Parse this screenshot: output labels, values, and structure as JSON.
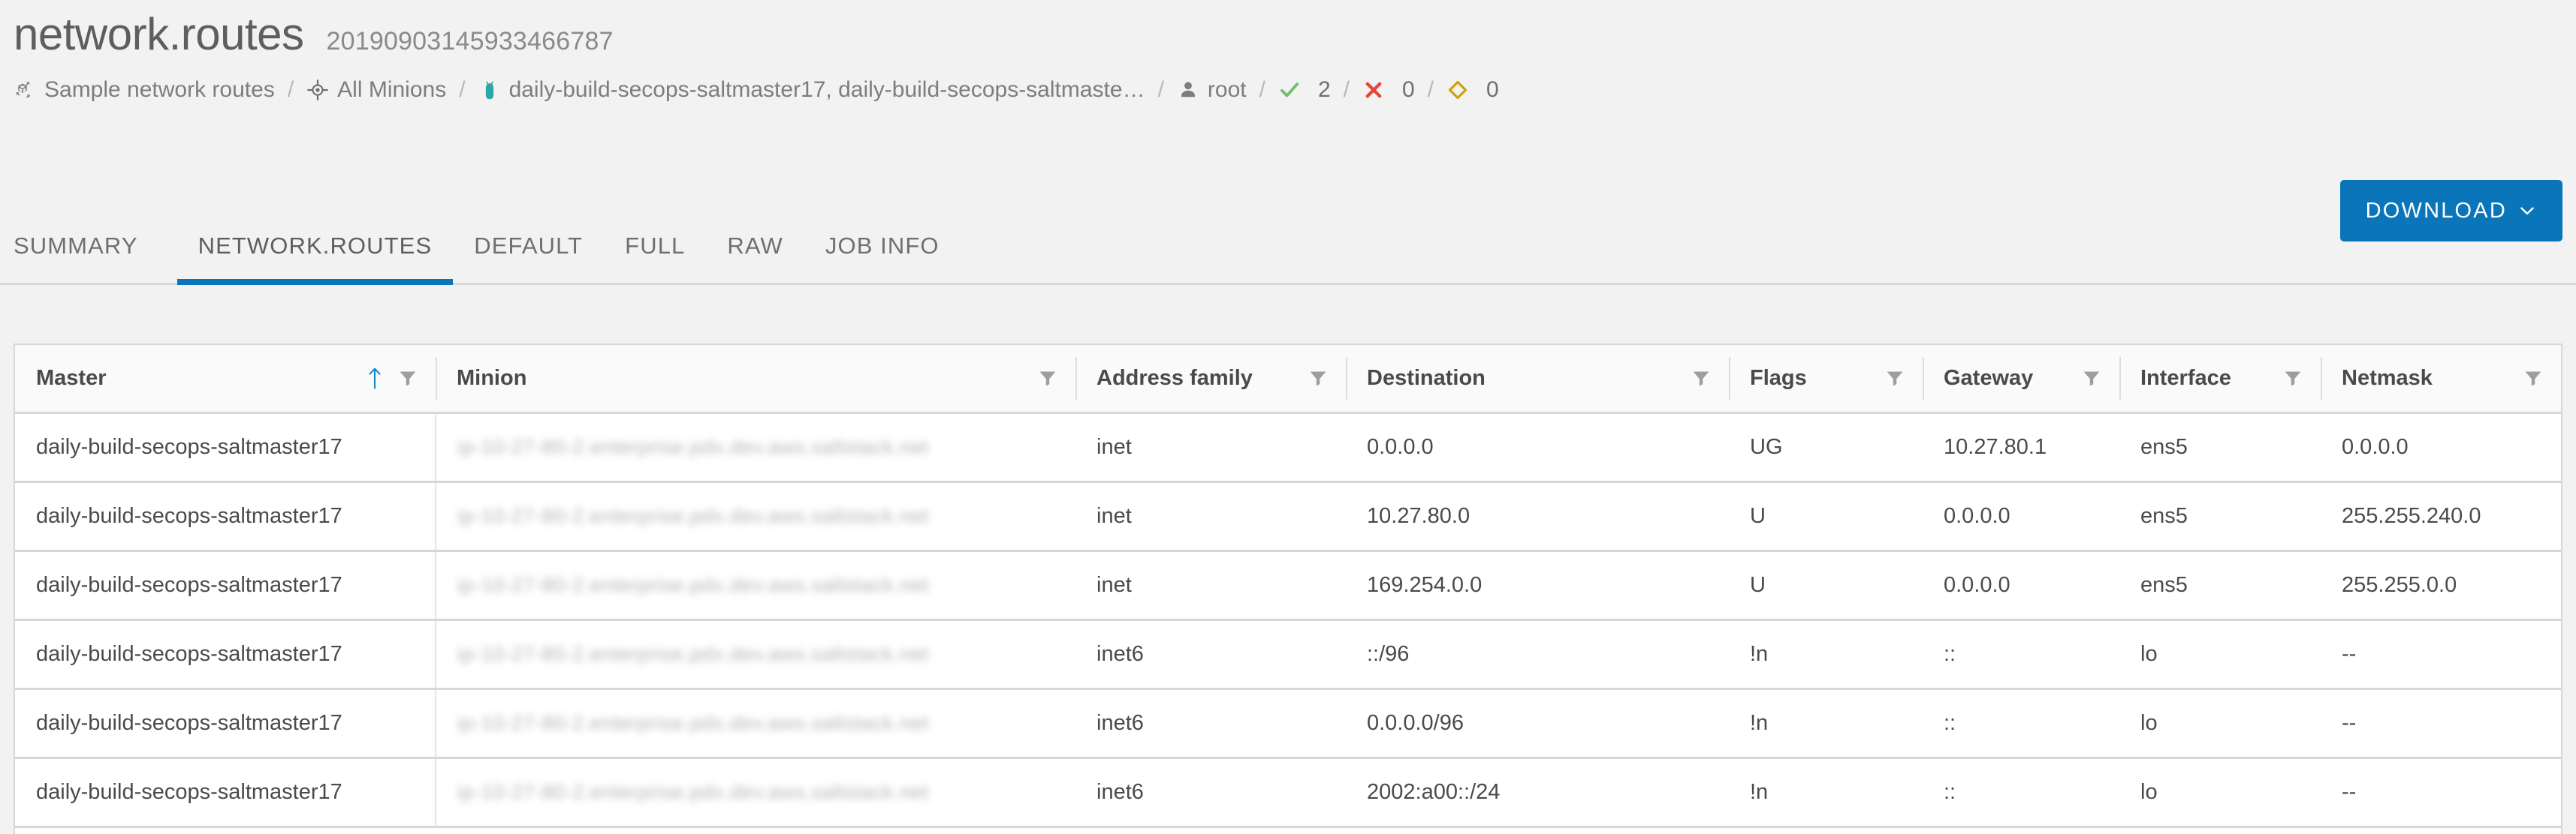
{
  "header": {
    "title": "network.routes",
    "job_id": "20190903145933466787"
  },
  "breadcrumb": {
    "separator": "/",
    "items": [
      {
        "icon": "state-cube-icon",
        "label": "Sample network routes"
      },
      {
        "icon": "target-icon",
        "label": "All Minions"
      },
      {
        "icon": "minion-icon",
        "label": "daily-build-secops-saltmaster17, daily-build-secops-saltmaste…"
      },
      {
        "icon": "user-icon",
        "label": "root"
      },
      {
        "icon": "check-icon",
        "label": "2"
      },
      {
        "icon": "x-icon",
        "label": "0"
      },
      {
        "icon": "diamond-icon",
        "label": "0"
      }
    ],
    "success_count": "2",
    "failed_count": "0",
    "warning_count": "0"
  },
  "toolbar": {
    "download_label": "DOWNLOAD",
    "download_chevron": "chevron-down-icon"
  },
  "tabs": [
    {
      "label": "SUMMARY",
      "active": false
    },
    {
      "label": "NETWORK.ROUTES",
      "active": true
    },
    {
      "label": "DEFAULT",
      "active": false
    },
    {
      "label": "FULL",
      "active": false
    },
    {
      "label": "RAW",
      "active": false
    },
    {
      "label": "JOB INFO",
      "active": false
    }
  ],
  "table": {
    "columns": [
      {
        "label": "Master",
        "sorted": "asc",
        "filterable": true
      },
      {
        "label": "Minion",
        "sorted": "",
        "filterable": true
      },
      {
        "label": "Address family",
        "sorted": "",
        "filterable": true
      },
      {
        "label": "Destination",
        "sorted": "",
        "filterable": true
      },
      {
        "label": "Flags",
        "sorted": "",
        "filterable": true
      },
      {
        "label": "Gateway",
        "sorted": "",
        "filterable": true
      },
      {
        "label": "Interface",
        "sorted": "",
        "filterable": true
      },
      {
        "label": "Netmask",
        "sorted": "",
        "filterable": true
      }
    ],
    "rows": [
      {
        "master": "daily-build-secops-saltmaster17",
        "minion": "ip-10-27-80-2.enterprise.pdx.dev.aws.saltstack.net",
        "family": "inet",
        "destination": "0.0.0.0",
        "flags": "UG",
        "gateway": "10.27.80.1",
        "interface": "ens5",
        "netmask": "0.0.0.0"
      },
      {
        "master": "daily-build-secops-saltmaster17",
        "minion": "ip-10-27-80-2.enterprise.pdx.dev.aws.saltstack.net",
        "family": "inet",
        "destination": "10.27.80.0",
        "flags": "U",
        "gateway": "0.0.0.0",
        "interface": "ens5",
        "netmask": "255.255.240.0"
      },
      {
        "master": "daily-build-secops-saltmaster17",
        "minion": "ip-10-27-80-2.enterprise.pdx.dev.aws.saltstack.net",
        "family": "inet",
        "destination": "169.254.0.0",
        "flags": "U",
        "gateway": "0.0.0.0",
        "interface": "ens5",
        "netmask": "255.255.0.0"
      },
      {
        "master": "daily-build-secops-saltmaster17",
        "minion": "ip-10-27-80-2.enterprise.pdx.dev.aws.saltstack.net",
        "family": "inet6",
        "destination": "::/96",
        "flags": "!n",
        "gateway": "::",
        "interface": "lo",
        "netmask": "--"
      },
      {
        "master": "daily-build-secops-saltmaster17",
        "minion": "ip-10-27-80-2.enterprise.pdx.dev.aws.saltstack.net",
        "family": "inet6",
        "destination": "0.0.0.0/96",
        "flags": "!n",
        "gateway": "::",
        "interface": "lo",
        "netmask": "--"
      },
      {
        "master": "daily-build-secops-saltmaster17",
        "minion": "ip-10-27-80-2.enterprise.pdx.dev.aws.saltstack.net",
        "family": "inet6",
        "destination": "2002:a00::/24",
        "flags": "!n",
        "gateway": "::",
        "interface": "lo",
        "netmask": "--"
      }
    ]
  },
  "colors": {
    "accent": "#0a76b9",
    "success": "#6dc06d",
    "danger": "#e8453c",
    "warning": "#d1a209",
    "minion_teal": "#2aa9a3",
    "page_bg": "#f2f2f2",
    "text": "#5e5e5e"
  }
}
